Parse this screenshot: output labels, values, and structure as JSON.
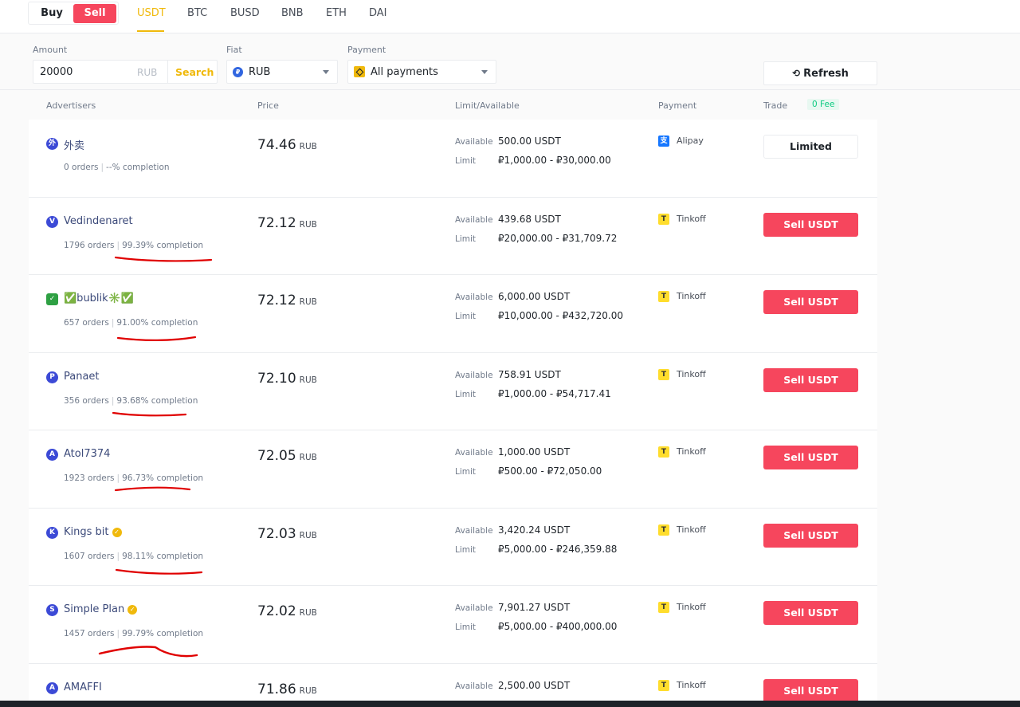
{
  "trade_toggle": {
    "buy": "Buy",
    "sell": "Sell"
  },
  "coins": [
    "USDT",
    "BTC",
    "BUSD",
    "BNB",
    "ETH",
    "DAI"
  ],
  "filters": {
    "amount_label": "Amount",
    "amount_value": "20000",
    "amount_unit": "RUB",
    "search_label": "Search",
    "fiat_label": "Fiat",
    "fiat_value": "RUB",
    "payment_label": "Payment",
    "payment_value": "All payments",
    "refresh_label": "Refresh"
  },
  "table_header": {
    "advertisers": "Advertisers",
    "price": "Price",
    "limit": "Limit/Available",
    "payment": "Payment",
    "trade": "Trade",
    "fee": "0 Fee"
  },
  "labels": {
    "available": "Available",
    "limit": "Limit"
  },
  "rows": [
    {
      "avatar": "外",
      "name": "外卖",
      "verified": false,
      "orders": "0 orders",
      "completion": "--% completion",
      "price": "74.46",
      "unit": "RUB",
      "available": "500.00 USDT",
      "limit": "₽1,000.00 - ₽30,000.00",
      "payment": "Alipay",
      "pay_icon": "alipay-icon",
      "action": "Limited"
    },
    {
      "avatar": "V",
      "name": "Vedindenaret",
      "verified": false,
      "orders": "1796 orders",
      "completion": "99.39% completion",
      "price": "72.12",
      "unit": "RUB",
      "available": "439.68 USDT",
      "limit": "₽20,000.00 - ₽31,709.72",
      "payment": "Tinkoff",
      "pay_icon": "tinkoff-icon",
      "action": "Sell USDT"
    },
    {
      "avatar": "✓",
      "name": "✅bublik✳️✅",
      "verified": false,
      "orders": "657 orders",
      "completion": "91.00% completion",
      "price": "72.12",
      "unit": "RUB",
      "available": "6,000.00 USDT",
      "limit": "₽10,000.00 - ₽432,720.00",
      "payment": "Tinkoff",
      "pay_icon": "tinkoff-icon",
      "action": "Sell USDT"
    },
    {
      "avatar": "P",
      "name": "Panaet",
      "verified": false,
      "orders": "356 orders",
      "completion": "93.68% completion",
      "price": "72.10",
      "unit": "RUB",
      "available": "758.91 USDT",
      "limit": "₽1,000.00 - ₽54,717.41",
      "payment": "Tinkoff",
      "pay_icon": "tinkoff-icon",
      "action": "Sell USDT"
    },
    {
      "avatar": "A",
      "name": "Atol7374",
      "verified": false,
      "orders": "1923 orders",
      "completion": "96.73% completion",
      "price": "72.05",
      "unit": "RUB",
      "available": "1,000.00 USDT",
      "limit": "₽500.00 - ₽72,050.00",
      "payment": "Tinkoff",
      "pay_icon": "tinkoff-icon",
      "action": "Sell USDT"
    },
    {
      "avatar": "K",
      "name": "Kings bit",
      "verified": true,
      "orders": "1607 orders",
      "completion": "98.11% completion",
      "price": "72.03",
      "unit": "RUB",
      "available": "3,420.24 USDT",
      "limit": "₽5,000.00 - ₽246,359.88",
      "payment": "Tinkoff",
      "pay_icon": "tinkoff-icon",
      "action": "Sell USDT"
    },
    {
      "avatar": "S",
      "name": "Simple Plan",
      "verified": true,
      "orders": "1457 orders",
      "completion": "99.79% completion",
      "price": "72.02",
      "unit": "RUB",
      "available": "7,901.27 USDT",
      "limit": "₽5,000.00 - ₽400,000.00",
      "payment": "Tinkoff",
      "pay_icon": "tinkoff-icon",
      "action": "Sell USDT"
    },
    {
      "avatar": "A",
      "name": "AMAFFI",
      "verified": false,
      "orders": "",
      "completion": "",
      "price": "71.86",
      "unit": "RUB",
      "available": "2,500.00 USDT",
      "limit": "",
      "payment": "Tinkoff",
      "pay_icon": "tinkoff-icon",
      "action": "Sell USDT"
    }
  ],
  "colors": {
    "accent": "#f0b90b",
    "sell": "#f6465d",
    "annotation": "#e00000"
  }
}
